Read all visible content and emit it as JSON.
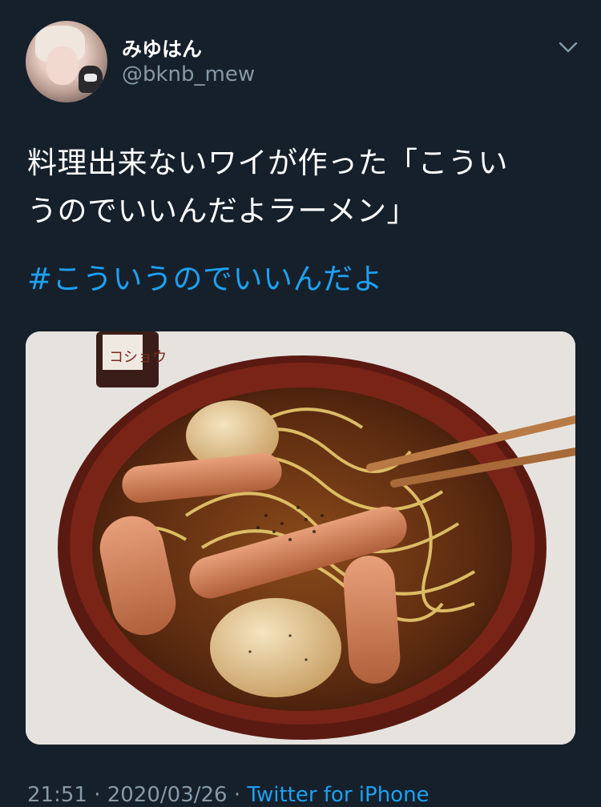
{
  "tweet": {
    "display_name": "みゆはん",
    "handle": "@bknb_mew",
    "text_line1": "料理出来ないワイが作った「こうい",
    "text_line2": "うのでいいんだよラーメン」",
    "hashtag": "#こういうのでいいんだよ",
    "photo_label": "コショウ",
    "timestamp": "21:51 · 2020/03/26 · ",
    "source": "Twitter for iPhone"
  },
  "colors": {
    "background": "#15202b",
    "text": "#ffffff",
    "secondary": "#8899a6",
    "link": "#1da1f2"
  },
  "icons": {
    "menu": "chevron-down-icon"
  }
}
